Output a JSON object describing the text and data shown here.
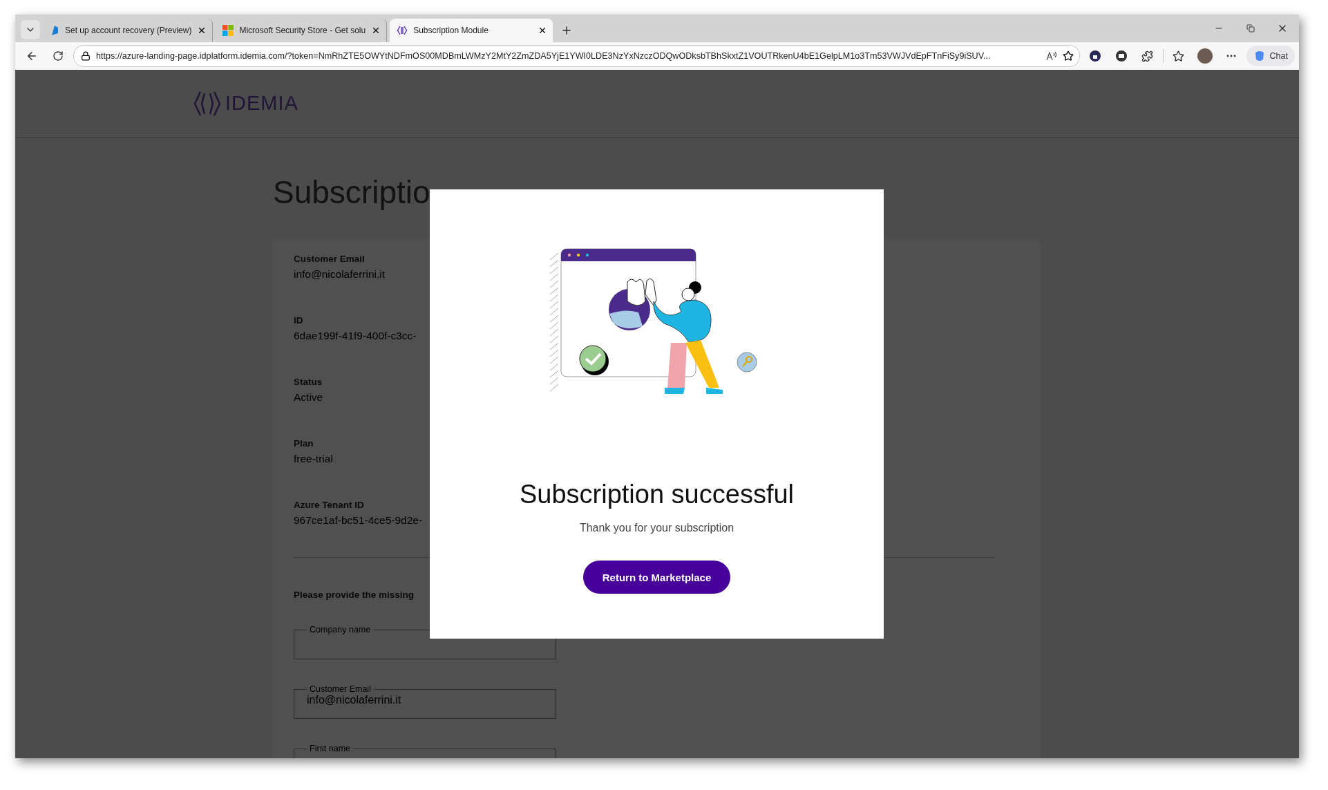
{
  "browser": {
    "tabs": [
      {
        "title": "Set up account recovery (Preview)",
        "selected": false
      },
      {
        "title": "Microsoft Security Store - Get solu",
        "selected": false
      },
      {
        "title": "Subscription Module",
        "selected": true
      }
    ],
    "address": "https://azure-landing-page.idplatform.idemia.com/?token=NmRhZTE5OWYtNDFmOS00MDBmLWMzY2MtY2ZmZDA5YjE1YWI0LDE3NzYxNzczODQwODksbTBhSkxtZ1VOUTRkenU4bE1GelpLM1o3Tm53VWJVdEpFTnFiSy9iSUV...",
    "chat_button": "Chat"
  },
  "page": {
    "logo": "IDEMIA",
    "title": "Subscriptio",
    "fields": [
      {
        "label": "Customer Email",
        "value": "info@nicolaferrini.it"
      },
      {
        "label": "ID",
        "value": "6dae199f-41f9-400f-c3cc-"
      },
      {
        "label": "Status",
        "value": "Active"
      },
      {
        "label": "Plan",
        "value": "free-trial"
      },
      {
        "label": "Azure Tenant ID",
        "value": "967ce1af-bc51-4ce5-9d2e-"
      }
    ],
    "prompt": "Please provide the missing",
    "inputs": [
      {
        "label": "Company name"
      },
      {
        "label": "Customer Email",
        "value": "info@nicolaferrini.it"
      },
      {
        "label": "First name"
      }
    ]
  },
  "modal": {
    "title": "Subscription successful",
    "message": "Thank you for your subscription",
    "button": "Return to Marketplace"
  }
}
